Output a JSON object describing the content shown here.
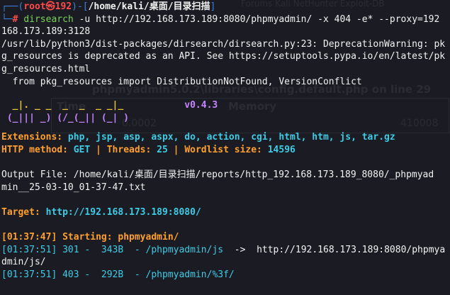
{
  "prompt": {
    "user": "root",
    "skull": "㉿",
    "host": "192",
    "path": "/home/kali/桌面/目录扫描",
    "cmd": "dirsearch",
    "args": " -u http://192.168.173.189:8080/phpmyadmin/ -x 404 -e* --proxy=192",
    "wrap": "168.173.189:3128"
  },
  "warning": [
    "/usr/lib/python3/dist-packages/dirsearch/dirsearch.py:23: DeprecationWarning: pk",
    "g_resources is deprecated as an API. See https://setuptools.pypa.io/en/latest/pk",
    "g_resources.html",
    "  from pkg_resources import DistributionNotFound, VersionConflict"
  ],
  "banner": {
    "line1": "  _|. _ _  _  _  _ _|_",
    "line2": " (_||| _) (/_(_|| (_| )",
    "version": "v0.4.3"
  },
  "config": {
    "ext_label": "Extensions: ",
    "ext_value": "php, jsp, asp, aspx, do, action, cgi, html, htm, js, tar.gz",
    "method_label": "HTTP method: ",
    "method_value": "GET",
    "sep": " | ",
    "threads_label": "Threads: ",
    "threads_value": "25",
    "wordlist_label": "Wordlist size: ",
    "wordlist_value": "14596"
  },
  "output": [
    "Output File: /home/kali/桌面/目录扫描/reports/http_192.168.173.189_8080/_phpmyad",
    "min__25-03-10_01-37-47.txt"
  ],
  "target": {
    "label": "Target: ",
    "url": "http://192.168.173.189:8080/"
  },
  "results": {
    "starting_time": "[01:37:47]",
    "starting_label": " Starting: phpmyadmin/",
    "r1_time": "[01:37:51]",
    "r1_code": " 301 -",
    "r1_size": "  343B",
    "r1_path": "  - /phpmyadmin/js",
    "r1_arrow": "  ->  ",
    "r1_redir": "http://192.168.173.189:8080/phpmya",
    "r1_wrap": "dmin/js/",
    "r2_time": "[01:37:51]",
    "r2_code": " 403 -",
    "r2_size": "  292B",
    "r2_path": "  - /phpmyadmin/%3f/"
  },
  "ghost": {
    "tabs": "Forums   Kali NetHunter   Exploit-DB",
    "title": "phpmyadmin5.0.2\\libraries\\config.default.php on line 29",
    "col_time": "Time",
    "col_memory": "Memory",
    "val_time": "0.0002",
    "val_memory": "410008"
  }
}
